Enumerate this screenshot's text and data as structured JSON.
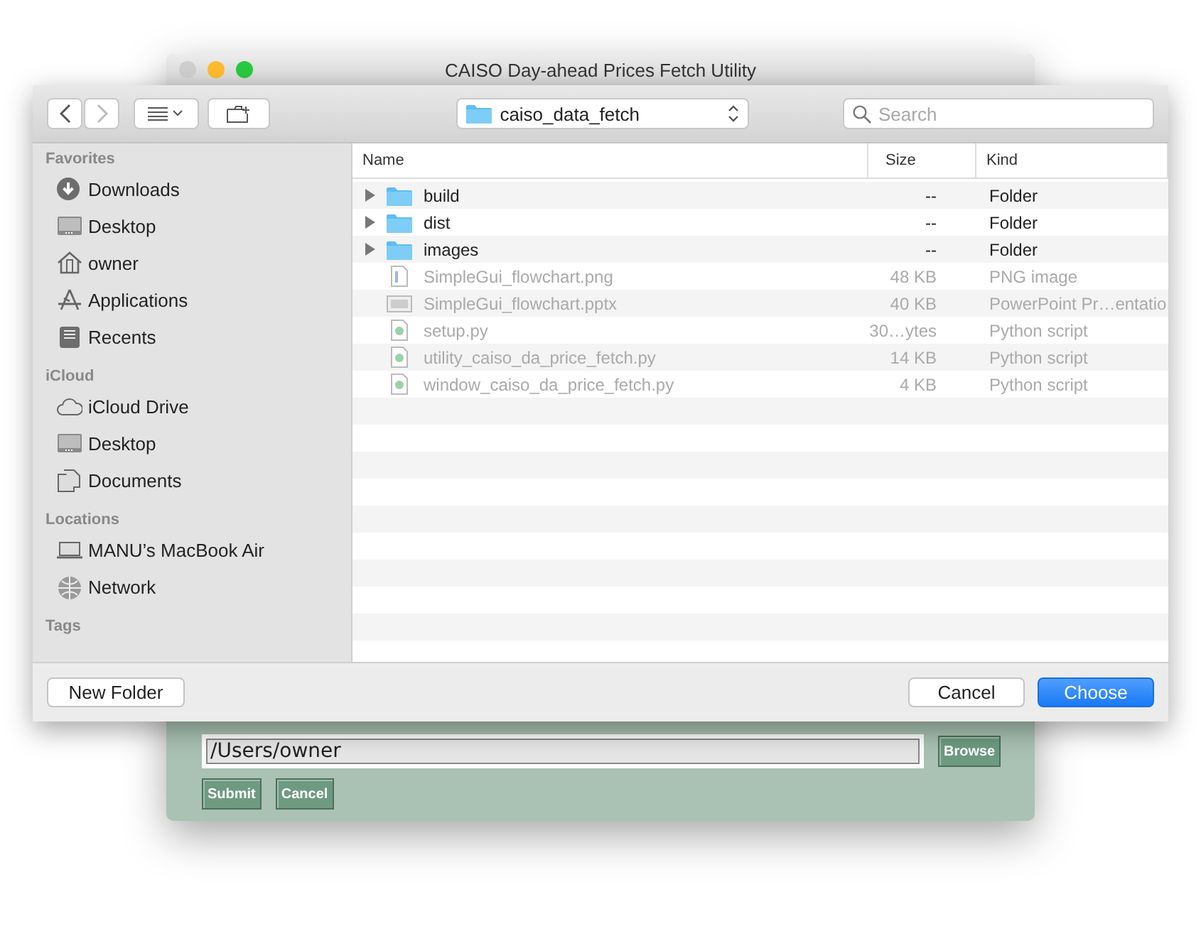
{
  "app_window": {
    "title": "CAISO Day-ahead Prices Fetch Utility",
    "path_field": {
      "value": "/Users/owner"
    },
    "browse_button": "Browse",
    "buttons": [
      "Submit",
      "Cancel"
    ]
  },
  "dialog": {
    "toolbar": {
      "back_enabled": true,
      "forward_enabled": false,
      "location": "caiso_data_fetch",
      "search": {
        "placeholder": "Search"
      }
    },
    "sidebar": [
      {
        "heading": "Favorites",
        "items": [
          "Downloads",
          "Desktop",
          "owner",
          "Applications",
          "Recents"
        ]
      },
      {
        "heading": "iCloud",
        "items": [
          "iCloud Drive",
          "Desktop",
          "Documents"
        ]
      },
      {
        "heading": "Locations",
        "items": [
          "MANU’s MacBook Air",
          "Network"
        ]
      },
      {
        "heading": "Tags"
      }
    ],
    "columns": [
      "Name",
      "Size",
      "Kind"
    ],
    "files": [
      {
        "kind": "folder",
        "name": "build",
        "size": "--",
        "type": "Folder",
        "disabled": false
      },
      {
        "kind": "folder",
        "name": "dist",
        "size": "--",
        "type": "Folder",
        "disabled": false
      },
      {
        "kind": "folder",
        "name": "images",
        "size": "--",
        "type": "Folder",
        "disabled": false
      },
      {
        "kind": "image",
        "name": "SimpleGui_flowchart.png",
        "size": "48 KB",
        "type": "PNG image",
        "disabled": true
      },
      {
        "kind": "document",
        "name": "SimpleGui_flowchart.pptx",
        "size": "40 KB",
        "type": "PowerPoint Pr…entatio",
        "disabled": true
      },
      {
        "kind": "script",
        "name": "setup.py",
        "size": "30…ytes",
        "type": "Python script",
        "disabled": true
      },
      {
        "kind": "script",
        "name": "utility_caiso_da_price_fetch.py",
        "size": "14 KB",
        "type": "Python script",
        "disabled": true
      },
      {
        "kind": "script",
        "name": "window_caiso_da_price_fetch.py",
        "size": "4 KB",
        "type": "Python script",
        "disabled": true
      }
    ],
    "footer": {
      "new_folder": "New Folder",
      "cancel": "Cancel",
      "choose": "Choose"
    }
  }
}
